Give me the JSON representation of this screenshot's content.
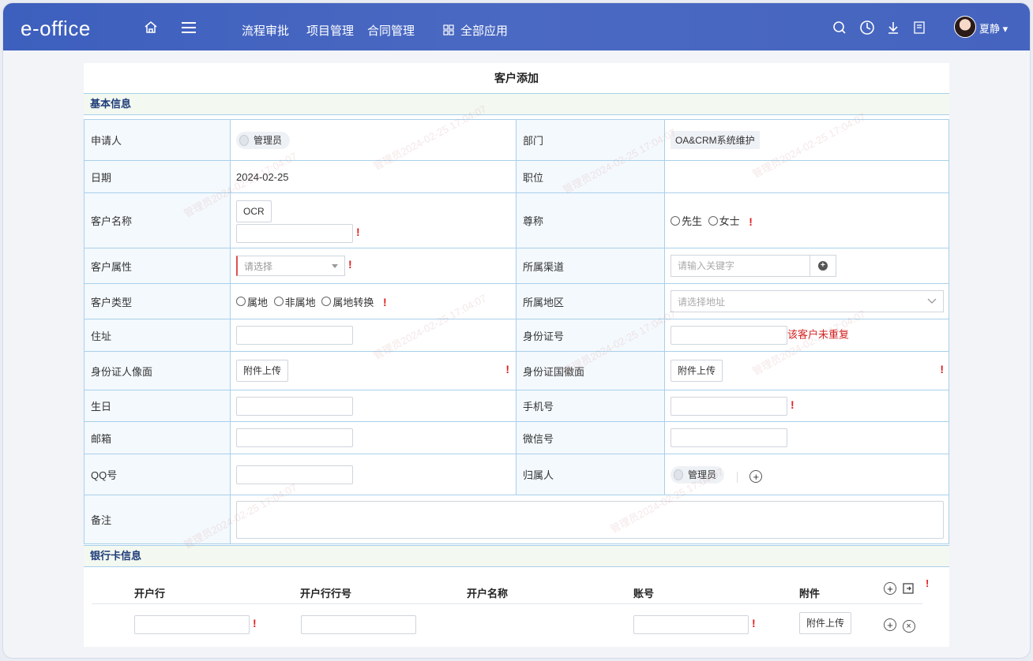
{
  "header": {
    "logo": "e-office",
    "nav": [
      "流程审批",
      "项目管理",
      "合同管理"
    ],
    "all_apps": "全部应用",
    "user": "夏静"
  },
  "page": {
    "title": "客户添加",
    "section_basic": "基本信息",
    "section_bank": "银行卡信息"
  },
  "form": {
    "applicant_label": "申请人",
    "applicant_value": "管理员",
    "dept_label": "部门",
    "dept_value": "OA&CRM系统维护",
    "date_label": "日期",
    "date_value": "2024-02-25",
    "position_label": "职位",
    "customer_name_label": "客户名称",
    "ocr_label": "OCR",
    "title_label": "尊称",
    "title_options": [
      "先生",
      "女士"
    ],
    "attr_label": "客户属性",
    "attr_placeholder": "请选择",
    "channel_label": "所属渠道",
    "channel_placeholder": "请输入关键字",
    "type_label": "客户类型",
    "type_options": [
      "属地",
      "非属地",
      "属地转换"
    ],
    "region_label": "所属地区",
    "region_placeholder": "请选择地址",
    "address_label": "住址",
    "idno_label": "身份证号",
    "idno_warning": "该客户未重复",
    "id_front_label": "身份证人像面",
    "id_back_label": "身份证国徽面",
    "upload_label": "附件上传",
    "birthday_label": "生日",
    "phone_label": "手机号",
    "email_label": "邮箱",
    "wechat_label": "微信号",
    "qq_label": "QQ号",
    "owner_label": "归属人",
    "owner_value": "管理员",
    "remark_label": "备注",
    "required_mark": "!"
  },
  "bank": {
    "columns": [
      "开户行",
      "开户行行号",
      "开户名称",
      "账号",
      "附件"
    ],
    "upload_label": "附件上传"
  },
  "watermark": "管理员2024-02-25 17:04:07",
  "colors": {
    "header": "#4564bf",
    "border": "#a9d0ea",
    "required": "#e02020"
  }
}
